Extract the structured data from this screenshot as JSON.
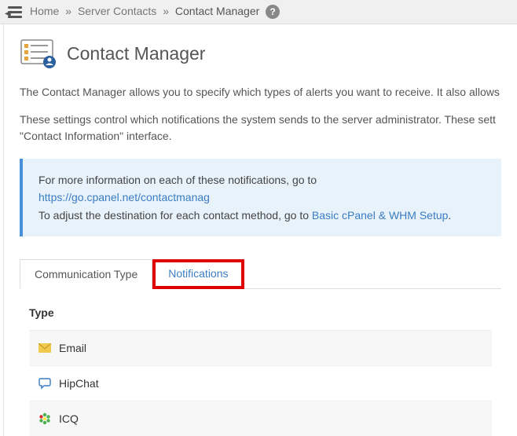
{
  "breadcrumb": {
    "home": "Home",
    "server_contacts": "Server Contacts",
    "current": "Contact Manager"
  },
  "header": {
    "title": "Contact Manager"
  },
  "desc": {
    "p1": "The Contact Manager allows you to specify which types of alerts you want to receive. It also allows",
    "p2_a": "These settings control which notifications the system sends to the server administrator. These sett",
    "p2_b": "\"Contact Information\" interface."
  },
  "infobox": {
    "line1_pre": "For more information on each of these notifications, go to ",
    "line1_link": "https://go.cpanel.net/contactmanag",
    "line2_pre": "To adjust the destination for each contact method, go to ",
    "line2_link": "Basic cPanel & WHM Setup",
    "line2_post": "."
  },
  "tabs": {
    "comm": "Communication Type",
    "notif": "Notifications"
  },
  "table": {
    "header": "Type",
    "rows": [
      {
        "label": "Email"
      },
      {
        "label": "HipChat"
      },
      {
        "label": "ICQ"
      }
    ]
  }
}
